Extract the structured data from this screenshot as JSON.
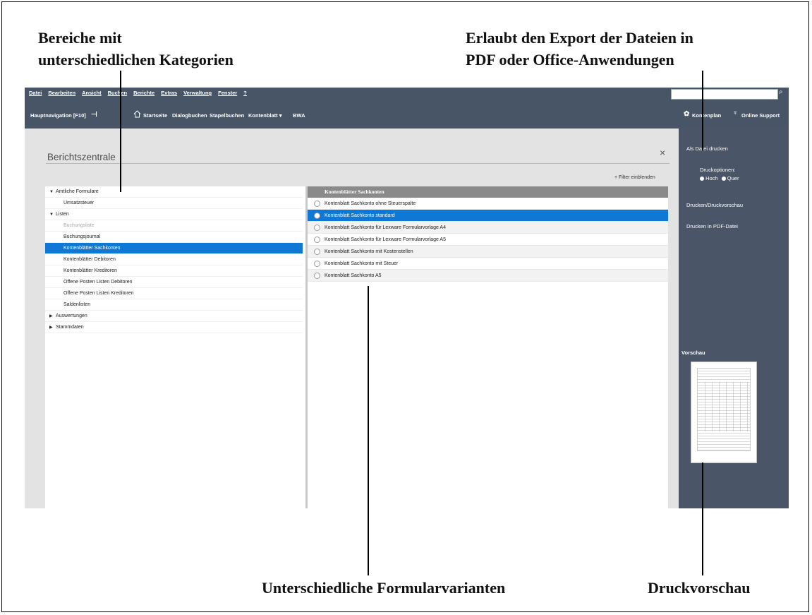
{
  "callouts": {
    "top_left": [
      "Bereiche mit",
      "unterschiedlichen  Kategorien"
    ],
    "top_right": [
      "Erlaubt den Export der Dateien in",
      "PDF oder Office-Anwendungen"
    ],
    "bottom_center": "Unterschiedliche  Formularvarianten",
    "bottom_right": "Druckvorschau"
  },
  "menubar": {
    "items": [
      "Datei",
      "Bearbeiten",
      "Ansicht",
      "Buchen",
      "Berichte",
      "Extras",
      "Verwaltung",
      "Fenster",
      "?"
    ],
    "search_value": ""
  },
  "navbar": {
    "hauptnavigation": "Hauptnavigation [F10]",
    "links": [
      "Startseite",
      "Dialogbuchen",
      "Stapelbuchen",
      "Kontenblatt ▾",
      "BWA"
    ],
    "kontenplan": "Kontenplan",
    "online_support": "Online Support"
  },
  "dialog": {
    "title": "Berichtszentrale",
    "filter_label": "+ Filter einblenden",
    "close_label": "×"
  },
  "tree": {
    "items": [
      {
        "label": "Amtliche Formulare",
        "state": "group-open"
      },
      {
        "label": "Umsatzsteuer",
        "state": "item"
      },
      {
        "label": "Listen",
        "state": "group-open"
      },
      {
        "label": "Buchungsliste",
        "state": "disabled"
      },
      {
        "label": "Buchungsjournal",
        "state": "item"
      },
      {
        "label": "Kontenblätter Sachkonten",
        "state": "selected"
      },
      {
        "label": "Kontenblätter Debitoren",
        "state": "item"
      },
      {
        "label": "Kontenblätter Kreditoren",
        "state": "item"
      },
      {
        "label": "Offene Posten Listen Debitoren",
        "state": "item"
      },
      {
        "label": "Offene Posten Listen Kreditoren",
        "state": "item"
      },
      {
        "label": "Saldenlisten",
        "state": "item"
      },
      {
        "label": "Auswertungen",
        "state": "group-closed"
      },
      {
        "label": "Stammdaten",
        "state": "group-closed"
      }
    ]
  },
  "forms": {
    "header": "Kontenblätter Sachkonten",
    "items": [
      {
        "label": "Kontenblatt Sachkonto ohne Steuerspalte",
        "selected": false
      },
      {
        "label": "Kontenblatt Sachkonto standard",
        "selected": true
      },
      {
        "label": "Kontenblatt Sachkonto für Lexware Formularvorlage A4",
        "selected": false
      },
      {
        "label": "Kontenblatt Sachkonto für Lexware Formularvorlage A5",
        "selected": false
      },
      {
        "label": "Kontenblatt Sachkonto mit Kostenstellen",
        "selected": false
      },
      {
        "label": "Kontenblatt Sachkonto mit Steuer",
        "selected": false
      },
      {
        "label": "Kontenblatt Sachkonto A5",
        "selected": false
      }
    ]
  },
  "sidebar": {
    "als_datei": "Als Datei drucken",
    "druckoptionen": "Druckoptionen:",
    "hoch": "Hoch",
    "quer": "Quer",
    "drucken_vorschau": "Drucken/Druckvorschau",
    "drucken_pdf": "Drucken in PDF-Datei",
    "vorschau": "Vorschau"
  },
  "colors": {
    "nav": "#485566",
    "side": "#4a5668",
    "selection": "#0f78d4"
  }
}
